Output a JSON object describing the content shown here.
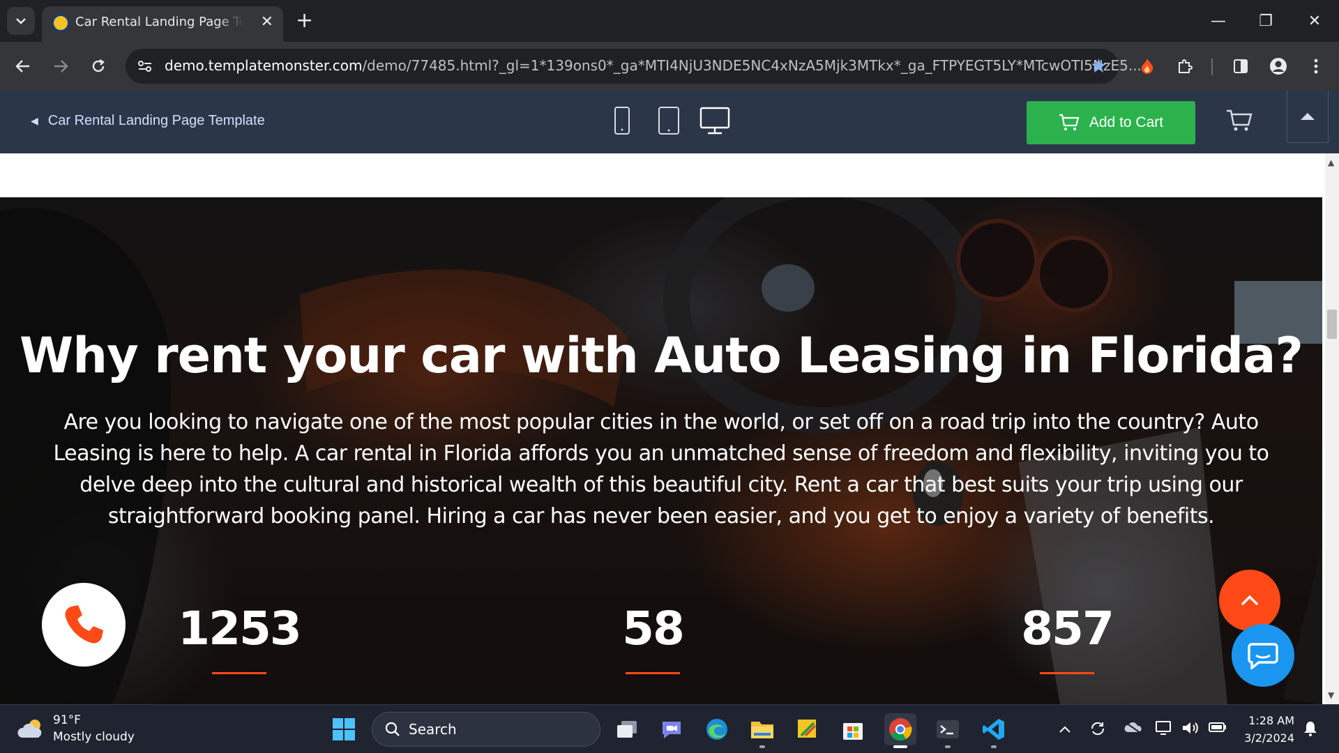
{
  "browser": {
    "tab": {
      "title": "Car Rental Landing Page Template",
      "close_glyph": "✕"
    },
    "new_tab_glyph": "+",
    "window": {
      "minimize": "—",
      "restore": "❐",
      "close": "✕"
    },
    "omnibox": {
      "url_host": "demo.templatemonster.com",
      "url_rest": "/demo/77485.html?_gl=1*139ons0*_ga*MTI4NjU3NDE5NC4xNzA5Mjk3MTkx*_ga_FTPYEGT5LY*MTcwOTI5NzE5..."
    }
  },
  "preview_bar": {
    "back_label": "Car Rental Landing Page Template",
    "add_to_cart_label": "Add to Cart",
    "colors": {
      "bar": "#2b3648",
      "cart_button": "#2bb24c"
    }
  },
  "hero": {
    "title": "Why rent your car with Auto Leasing in Florida?",
    "body": "Are you looking to navigate one of the most popular cities in the world, or set off on a road trip into the country? Auto Leasing is here to help. A car rental in Florida affords you an unmatched sense of freedom and flexibility, inviting you to delve deep into the cultural and historical wealth of this beautiful city. Rent a car that best suits your trip using our straightforward booking panel. Hiring a car has never been easier, and you get to enjoy a variety of benefits.",
    "stats": [
      {
        "value": "1253"
      },
      {
        "value": "58"
      },
      {
        "value": "857"
      }
    ],
    "colors": {
      "accent": "#ff4a17",
      "chat": "#1a96f0"
    }
  },
  "taskbar": {
    "weather": {
      "temp": "91°F",
      "condition": "Mostly cloudy"
    },
    "search_placeholder": "Search",
    "clock": {
      "time": "1:28 AM",
      "date": "3/2/2024"
    }
  }
}
